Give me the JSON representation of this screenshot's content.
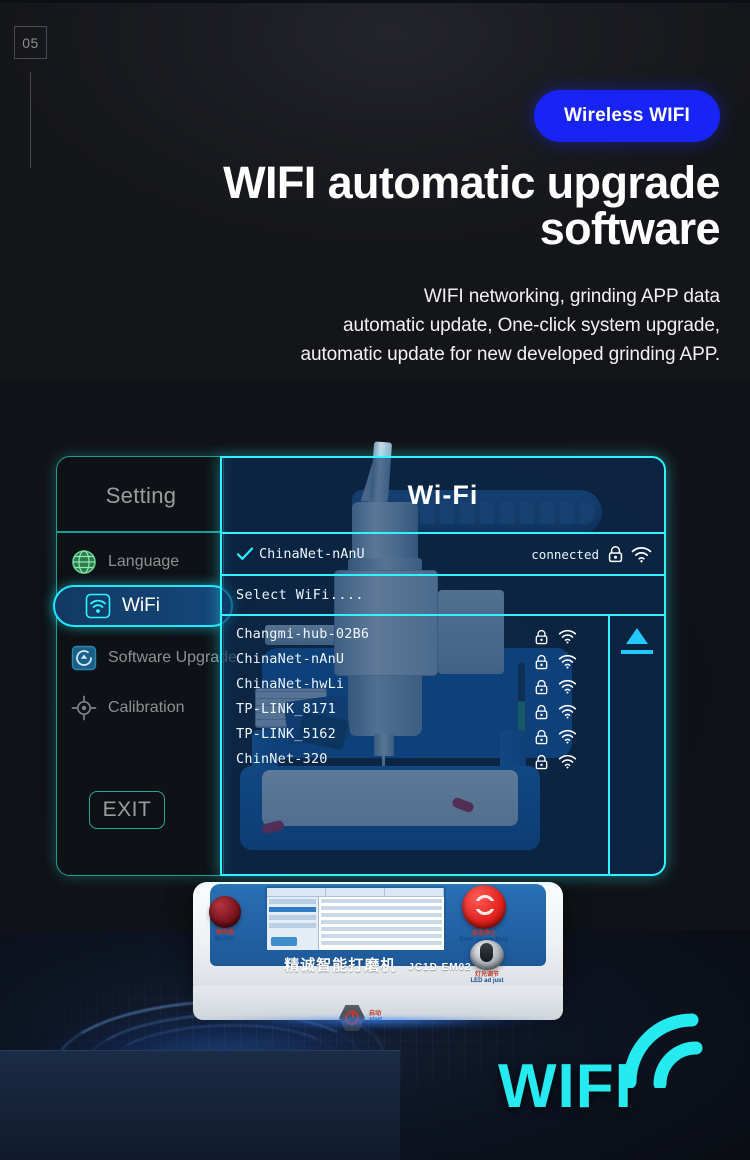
{
  "index_badge": "05",
  "header": {
    "pill_label": "Wireless WIFI",
    "title_line1": "WIFI automatic",
    "title_line2": "upgrade software",
    "sub_line1": "WIFI networking, grinding APP data",
    "sub_line2": "automatic update, One-click system upgrade,",
    "sub_line3": "automatic update  for new developed grinding APP."
  },
  "settings_panel": {
    "title": "Setting",
    "nav_items": [
      {
        "label": "Language",
        "icon": "globe-icon",
        "active": false
      },
      {
        "label": "WiFi",
        "icon": "wifi-icon",
        "active": true
      },
      {
        "label": "Software Upgrade",
        "icon": "upgrade-icon",
        "active": false
      },
      {
        "label": "Calibration",
        "icon": "target-icon",
        "active": false
      }
    ],
    "exit_label": "EXIT"
  },
  "wifi_panel": {
    "header_title": "Wi-Fi",
    "connected": {
      "ssid": "ChinaNet-nAnU",
      "status": "connected",
      "check_icon": "check-icon",
      "lock_icon": "lock-icon",
      "signal_icon": "wifi-signal-icon"
    },
    "select_label": "Select WiFi....",
    "networks": [
      {
        "ssid": "Changmi-hub-02B6",
        "lock_icon": "lock-icon",
        "signal_icon": "wifi-signal-icon"
      },
      {
        "ssid": "ChinaNet-nAnU",
        "lock_icon": "lock-icon",
        "signal_icon": "wifi-signal-icon"
      },
      {
        "ssid": "ChinaNet-hwLi",
        "lock_icon": "lock-icon",
        "signal_icon": "wifi-signal-icon"
      },
      {
        "ssid": "TP-LINK_8171",
        "lock_icon": "lock-icon",
        "signal_icon": "wifi-signal-icon"
      },
      {
        "ssid": "TP-LINK_5162",
        "lock_icon": "lock-icon",
        "signal_icon": "wifi-signal-icon"
      },
      {
        "ssid": "ChinNet-320",
        "lock_icon": "lock-icon",
        "signal_icon": "wifi-signal-icon"
      }
    ],
    "scroll_up_icon": "triangle-up-icon"
  },
  "machine": {
    "brand_cn": "精诚智能打磨机",
    "model": "JC1D EM02",
    "controls": [
      {
        "cn": "蜂鸣器",
        "en": "Buzzer",
        "icon": "buzzer-knob-icon"
      },
      {
        "cn": "紧急停止",
        "en": "Emer gency Stop",
        "icon": "emergency-stop-icon"
      },
      {
        "cn": "灯光调节",
        "en": "LED ad just",
        "icon": "led-knob-icon"
      },
      {
        "cn": "启动",
        "en": "start",
        "icon": "power-button-icon"
      }
    ]
  },
  "watermark": {
    "text": "WIFI",
    "icon": "wifi-arc-icon"
  },
  "colors": {
    "accent_cyan": "#2ff3ff",
    "pill_blue": "#1724f5",
    "panel_blue": "#0a305c",
    "teal_border": "#1f9d93",
    "text_grey": "#8e9094"
  }
}
